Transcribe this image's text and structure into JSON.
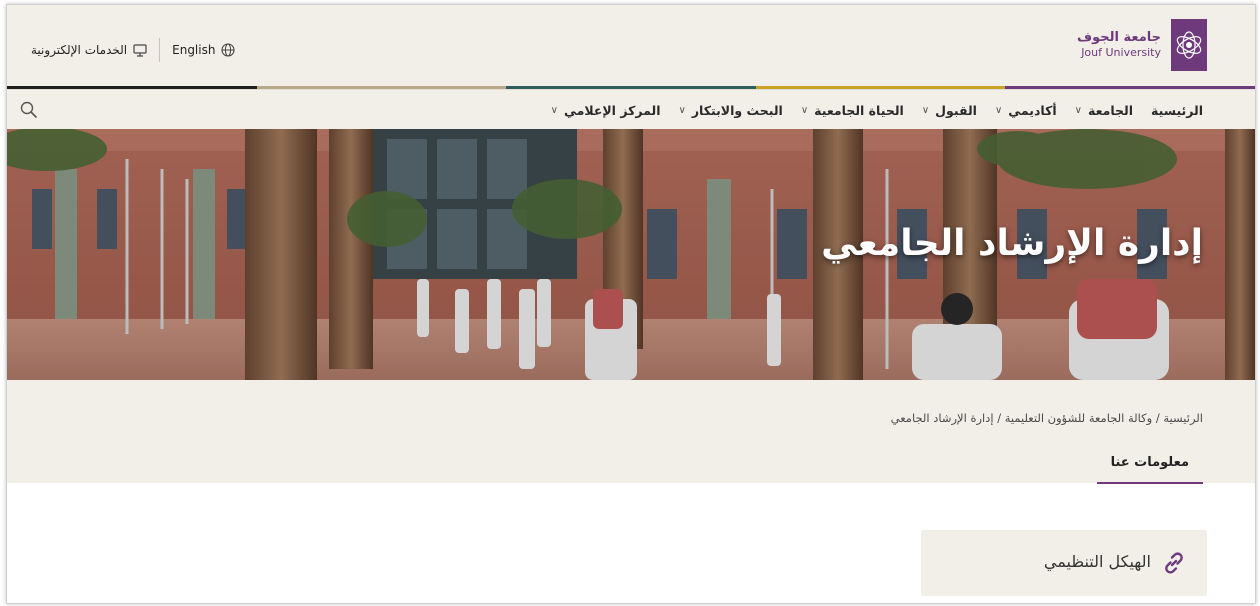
{
  "brand": {
    "name_ar": "جامعة الجوف",
    "name_en": "Jouf University"
  },
  "utility": {
    "english_label": "English",
    "eservices_label": "الخدمات الإلكترونية"
  },
  "nav": {
    "items": [
      {
        "label": "الرئيسية",
        "has_dropdown": false
      },
      {
        "label": "الجامعة",
        "has_dropdown": true
      },
      {
        "label": "أكاديمي",
        "has_dropdown": true
      },
      {
        "label": "القبول",
        "has_dropdown": true
      },
      {
        "label": "الحياة الجامعية",
        "has_dropdown": true
      },
      {
        "label": "البحث والابتكار",
        "has_dropdown": true
      },
      {
        "label": "المركز الإعلامي",
        "has_dropdown": true
      }
    ],
    "search_icon": "search-icon"
  },
  "hero": {
    "title": "إدارة الإرشاد الجامعي"
  },
  "breadcrumb": {
    "text": "الرئيسية / وكالة الجامعة للشؤون التعليمية / إدارة الإرشاد الجامعي"
  },
  "tabs": {
    "about": "معلومات عنا"
  },
  "card": {
    "label": "الهيكل التنظيمي",
    "icon": "link-icon"
  },
  "colors": {
    "brand_purple": "#6e3a7c",
    "header_bg": "#f2efe9"
  }
}
